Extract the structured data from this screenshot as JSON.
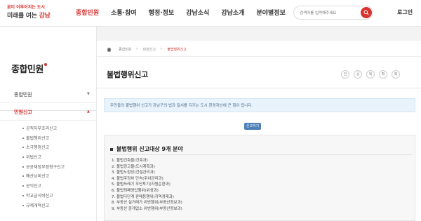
{
  "header": {
    "logo_line1": "꿈이 이루어지는 도시",
    "logo_line2_a": "미래를 여는 ",
    "logo_line2_b": "강남",
    "nav": [
      {
        "label": "종합민원",
        "active": true
      },
      {
        "label": "소통·참여",
        "active": false
      },
      {
        "label": "행정·정보",
        "active": false
      },
      {
        "label": "강남소식",
        "active": false
      },
      {
        "label": "강남소개",
        "active": false
      },
      {
        "label": "분야별정보",
        "active": false
      }
    ],
    "search_placeholder": "검색어를 입력해주세요",
    "login_label": "로그인"
  },
  "sidebar": {
    "title": "종합민원",
    "menus": [
      {
        "label": "종합민원",
        "arrow": "▼",
        "active": false
      },
      {
        "label": "민원신고",
        "arrow": "▲",
        "active": true
      }
    ],
    "submenu": [
      "공직자부조리신고",
      "불법행위신고",
      "소극행정신고",
      "위법신고",
      "공공재정부정청구신고",
      "예산낭비신고",
      "공익신고",
      "학교급식비신고",
      "규제개혁신고"
    ]
  },
  "content": {
    "breadcrumb": [
      "종합민원",
      "민원신고",
      "불법행위신고"
    ],
    "title": "불법행위신고",
    "tools": [
      "인",
      "공",
      "북",
      "확",
      "축"
    ],
    "notice": "주민들의 불법행위 신고가 강남구의 법과 질서를 지키는 도시 환경개선에 큰 힘이 됩니다.",
    "help_button": "신고하기",
    "box_title": "불법행위 신고대상 9개 분야",
    "items": [
      "1. 불법건축물(건축과)",
      "2. 불법광고물(도시계획과)",
      "3. 불법노점상(건설관리과)",
      "4. 불법주정차 단속(주차관리과)",
      "5. 불법쓰레기 무단투기(자원순환과)",
      "6. 불법퇴폐영업행위(위생과)",
      "7. 불법다단계 판매등행위(지역경제과)",
      "8. 부동산 실거래가 위반행위(부동산정보과)",
      "9. 부동산 중개업소 위반행위(부동산정보과)"
    ]
  },
  "colors": {
    "accent": "#d7332f",
    "notice_bg": "#e9f3fb",
    "button_blue": "#4a7fb8"
  }
}
